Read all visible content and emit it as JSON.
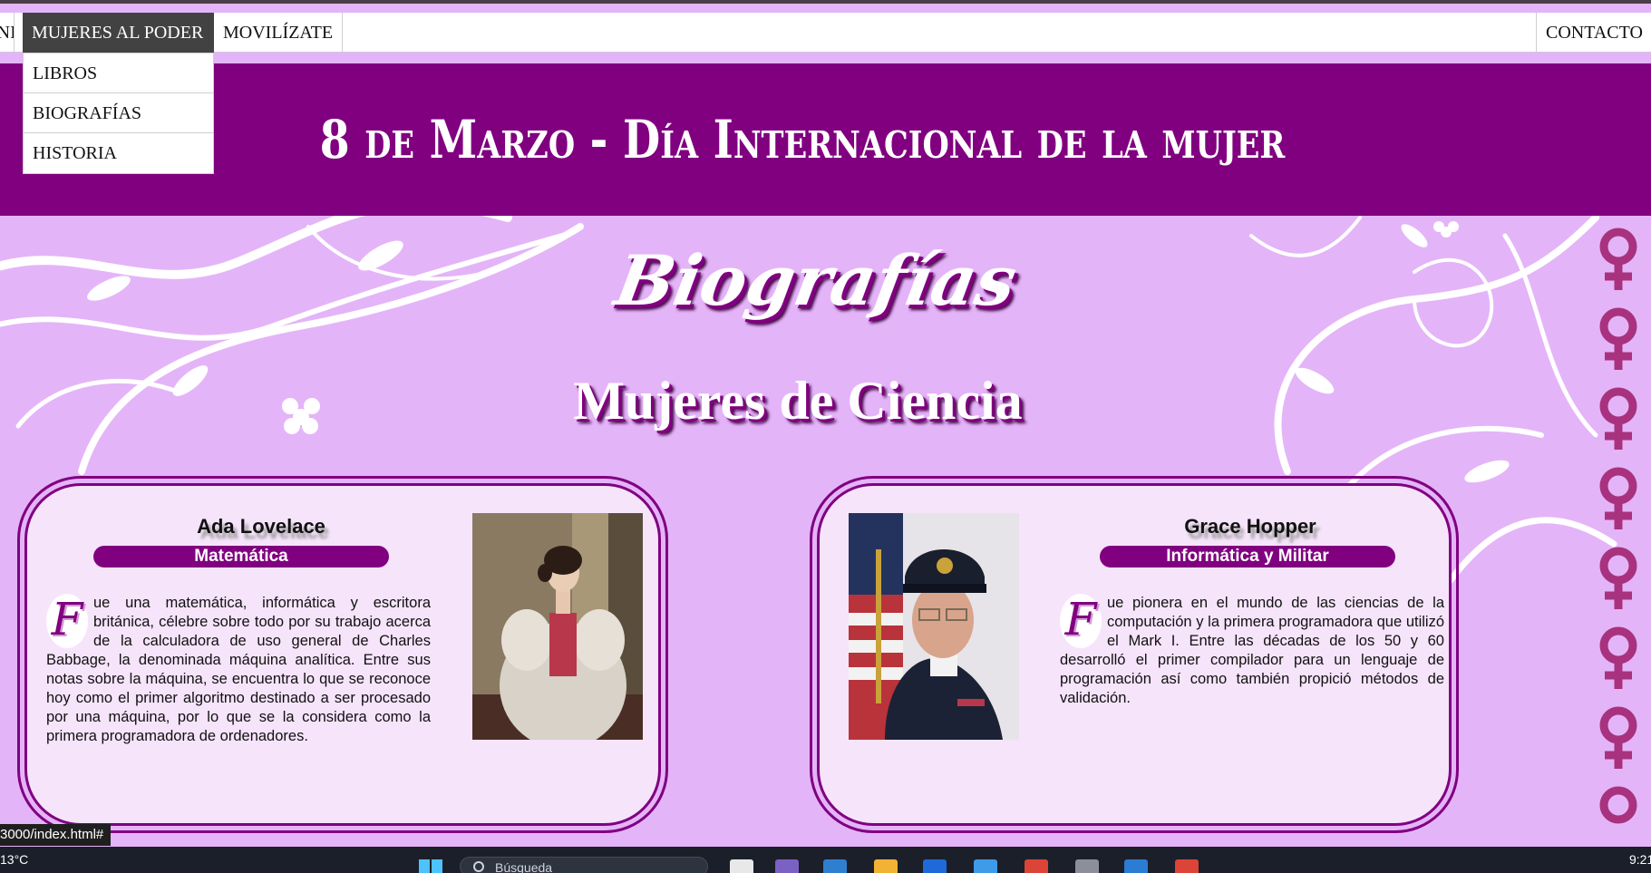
{
  "nav": {
    "inicio_label": "INICIO",
    "mujeres_label": "MUJERES AL PODER",
    "movilizate_label": "MOVILÍZATE",
    "contacto_label": "CONTACTO",
    "dropdown": [
      "LIBROS",
      "BIOGRAFÍAS",
      "HISTORIA"
    ]
  },
  "banner": {
    "title": "8 de Marzo - Día Internacional de la mujer"
  },
  "headings": {
    "biografias": "Biografías",
    "ciencia": "Mujeres de Ciencia"
  },
  "cards": [
    {
      "name": "Ada Lovelace",
      "role": "Matemática",
      "dropcap": "F",
      "text": "ue una matemática, informática y escritora británica, célebre sobre todo por su trabajo acerca de la calculadora de uso general de Charles Babbage, la denominada máquina analítica. Entre sus notas sobre la máquina, se encuentra lo que se reconoce hoy como el primer algoritmo destinado a ser procesado por una máquina, por lo que se la considera como la primera programadora de ordenadores."
    },
    {
      "name": "Grace Hopper",
      "role": "Informática y Militar",
      "dropcap": "F",
      "text": "ue pionera en el mundo de las ciencias de la computación y la primera programadora que utilizó el Mark I. Entre las décadas de los 50 y 60 desarrolló el primer compilador para un lenguaje de programación así como también propició métodos de validación."
    }
  ],
  "status": {
    "url_tooltip": "3000/index.html#"
  },
  "taskbar": {
    "weather": "13°C",
    "search_placeholder": "Búsqueda",
    "time": "9:21"
  },
  "colors": {
    "purple": "#800080",
    "lavender": "#e4b4f8",
    "card": "#f6e4fb"
  }
}
